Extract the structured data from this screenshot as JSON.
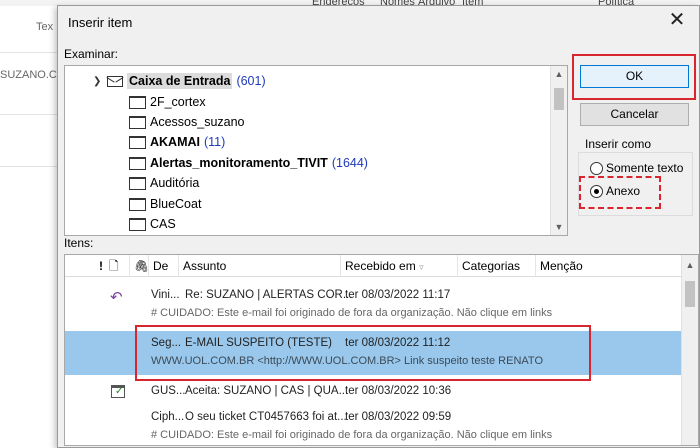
{
  "background": {
    "tabs": [
      "Endereços",
      "Nomes",
      "Arquivo",
      "Item",
      "Política"
    ],
    "left_text_1": "Tex",
    "left_text_2": "SUZANO.C"
  },
  "dialog": {
    "title": "Inserir item",
    "close": "✕",
    "examinar_label": "Examinar:",
    "itens_label": "Itens:",
    "folders": [
      {
        "label": "Caixa de Entrada",
        "count": "(601)"
      },
      {
        "label": "2F_cortex",
        "count": ""
      },
      {
        "label": "Acessos_suzano",
        "count": ""
      },
      {
        "label": "AKAMAI",
        "count": "(11)"
      },
      {
        "label": "Alertas_monitoramento_TIVIT",
        "count": "(1644)"
      },
      {
        "label": "Auditória",
        "count": ""
      },
      {
        "label": "BlueCoat",
        "count": ""
      },
      {
        "label": "CAS",
        "count": ""
      }
    ],
    "ok_label": "OK",
    "cancel_label": "Cancelar",
    "insert_as": {
      "legend": "Inserir como",
      "option_text": "Somente texto",
      "option_attach": "Anexo",
      "selected": "Anexo"
    },
    "columns": {
      "importance": "!",
      "icon": "🗋",
      "attach": "🖇",
      "from": "De",
      "subject": "Assunto",
      "received": "Recebido em",
      "categories": "Categorias",
      "mention": "Menção"
    },
    "messages": [
      {
        "from": "Vini...",
        "subject": "Re: SUZANO | ALERTAS COR...",
        "received": "ter 08/03/2022 11:17",
        "preview": "# CUIDADO: Este e-mail foi originado de fora da organização. Não clique em links",
        "icon": "reply-icon"
      },
      {
        "from": "Seg...",
        "subject": "E-MAIL SUSPEITO (TESTE)",
        "received": "ter 08/03/2022 11:12",
        "preview": "WWW.UOL.COM.BR <http://WWW.UOL.COM.BR>   Link suspeito teste  RENATO",
        "icon": ""
      },
      {
        "from": "GUS...",
        "subject": "Aceita: SUZANO | CAS | QUA...",
        "received": "ter 08/03/2022 10:36",
        "preview": "",
        "icon": "meeting-accepted-icon"
      },
      {
        "from": "Ciph...",
        "subject": "O seu ticket CT0457663 foi at...",
        "received": "ter 08/03/2022 09:59",
        "preview": "# CUIDADO: Este e-mail foi originado de fora da organização. Não clique em links",
        "icon": ""
      }
    ]
  }
}
